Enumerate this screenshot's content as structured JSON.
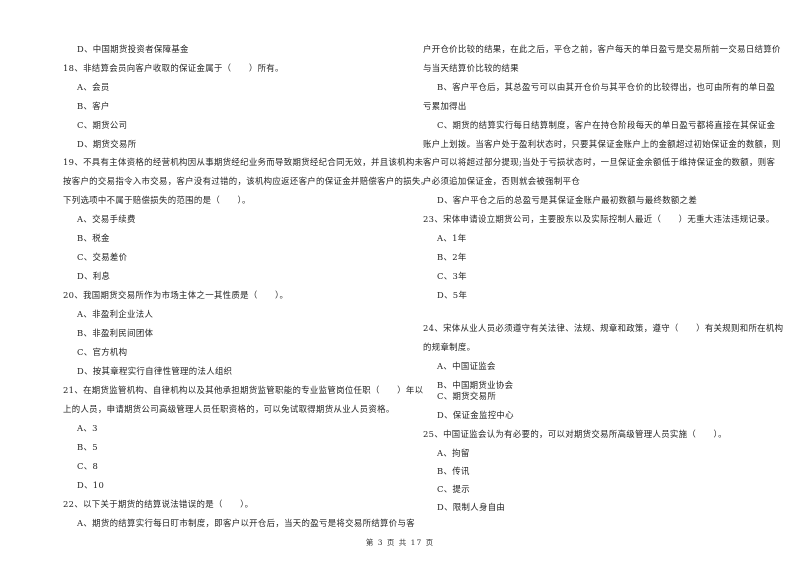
{
  "page": {
    "footer": "第 3 页 共 17 页"
  },
  "left_column": {
    "q17_tail": {
      "options": [
        {
          "label": "D、中国期货投资者保障基金"
        }
      ]
    },
    "q18": {
      "stem": "18、非结算会员向客户收取的保证金属于（　　）所有。",
      "options": [
        {
          "label": "A、会员"
        },
        {
          "label": "B、客户"
        },
        {
          "label": "C、期货公司"
        },
        {
          "label": "D、期货交易所"
        }
      ]
    },
    "q19": {
      "stem_lines": [
        "19、不具有主体资格的经营机构因从事期货经纪业务而导致期货经纪合同无效，并且该机构未",
        "按客户的交易指令入市交易，客户没有过错的，该机构应返还客户的保证金并赔偿客户的损失。",
        "下列选项中不属于赔偿损失的范围的是（　　）。"
      ],
      "options": [
        {
          "label": "A、交易手续费"
        },
        {
          "label": "B、税金"
        },
        {
          "label": "C、交易差价"
        },
        {
          "label": "D、利息"
        }
      ]
    },
    "q20": {
      "stem": "20、我国期货交易所作为市场主体之一其性质是（　　）。",
      "options": [
        {
          "label": "A、非盈利企业法人"
        },
        {
          "label": "B、非盈利民间团体"
        },
        {
          "label": "C、官方机构"
        },
        {
          "label": "D、按其章程实行自律性管理的法人组织"
        }
      ]
    },
    "q21": {
      "stem_lines": [
        "21、在期货监管机构、自律机构以及其他承担期货监管职能的专业监管岗位任职（　　）年以",
        "上的人员，申请期货公司高级管理人员任职资格的，可以免试取得期货从业人员资格。"
      ],
      "options": [
        {
          "label": "A、3"
        },
        {
          "label": "B、5"
        },
        {
          "label": "C、8"
        },
        {
          "label": "D、10"
        }
      ]
    },
    "q22": {
      "stem": "22、以下关于期货的结算说法错误的是（　　）。",
      "option_a_line1": "A、期货的结算实行每日盯市制度，即客户以开仓后，当天的盈亏是将交易所结算价与客"
    }
  },
  "right_column": {
    "q22_cont": {
      "a_lines": [
        "户开仓价比较的结果，在此之后，平仓之前，客户每天的单日盈亏是交易所前一交易日结算价",
        "与当天结算价比较的结果"
      ],
      "b_lines": [
        "B、客户平仓后，其总盈亏可以由其开仓价与其平仓价的比较得出，也可由所有的单日盈",
        "亏累加得出"
      ],
      "c_lines": [
        "C、期货的结算实行每日结算制度，客户在持仓阶段每天的单日盈亏都将直接在其保证金",
        "账户上划拨。当客户处于盈利状态时，只要其保证金账户上的金额超过初始保证金的数额，则",
        "客户可以将超过部分提现;当处于亏损状态时，一旦保证金余额低于维持保证金的数额，则客",
        "户必须追加保证金，否则就会被强制平仓"
      ],
      "d_line": "D、客户平仓之后的总盈亏是其保证金账户最初数额与最终数额之差"
    },
    "q23": {
      "stem": "23、宋体申请设立期货公司，主要股东以及实际控制人最近（　　）无重大违法违规记录。",
      "options": [
        {
          "label": "A、1年"
        },
        {
          "label": "B、2年"
        },
        {
          "label": "C、3年"
        },
        {
          "label": "D、5年"
        }
      ]
    },
    "q24": {
      "stem_lines": [
        "24、宋体从业人员必须遵守有关法律、法规、规章和政策，遵守（　　）有关规则和所在机构",
        "的规章制度。"
      ],
      "options": [
        {
          "label": "A、中国证监会"
        },
        {
          "label": "B、中国期货业协会"
        },
        {
          "label": "C、期货交易所"
        },
        {
          "label": "D、保证金监控中心"
        }
      ]
    },
    "q25": {
      "stem": "25、中国证监会认为有必要的，可以对期货交易所高级管理人员实施（　　）。",
      "options": [
        {
          "label": "A、拘留"
        },
        {
          "label": "B、传讯"
        },
        {
          "label": "C、提示"
        },
        {
          "label": "D、限制人身自由"
        }
      ]
    }
  }
}
